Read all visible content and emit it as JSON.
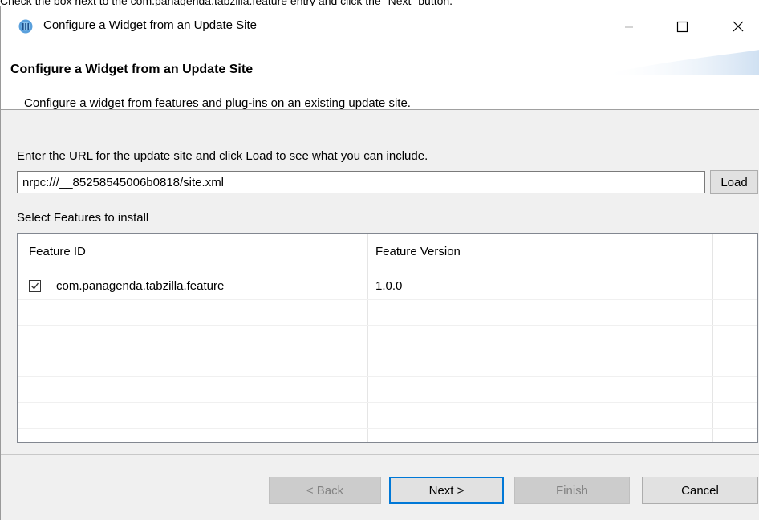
{
  "instruction": "Check the box next to the com.panagenda.tabzilla.feature entry and click the \"Next\" button.",
  "window": {
    "title": "Configure a Widget from an Update Site",
    "icon": "app-icon",
    "controls": {
      "minimize": "—",
      "maximize": "☐",
      "close": "✕"
    }
  },
  "wizard": {
    "title": "Configure a Widget from an Update Site",
    "description": "Configure a widget from features and plug-ins on an existing update site."
  },
  "url_section": {
    "prompt": "Enter the URL for the update site and click Load to see what you can include.",
    "url_value": "nrpc:///__85258545006b0818/site.xml",
    "load_label": "Load"
  },
  "features": {
    "label": "Select Features to install",
    "columns": [
      "Feature ID",
      "Feature Version"
    ],
    "rows": [
      {
        "id": "com.panagenda.tabzilla.feature",
        "version": "1.0.0",
        "checked": true
      }
    ]
  },
  "buttons": {
    "back": "< Back",
    "next": "Next >",
    "finish": "Finish",
    "cancel": "Cancel"
  },
  "colors": {
    "accent": "#0078d7",
    "dialog_bg": "#f0f0f0"
  }
}
